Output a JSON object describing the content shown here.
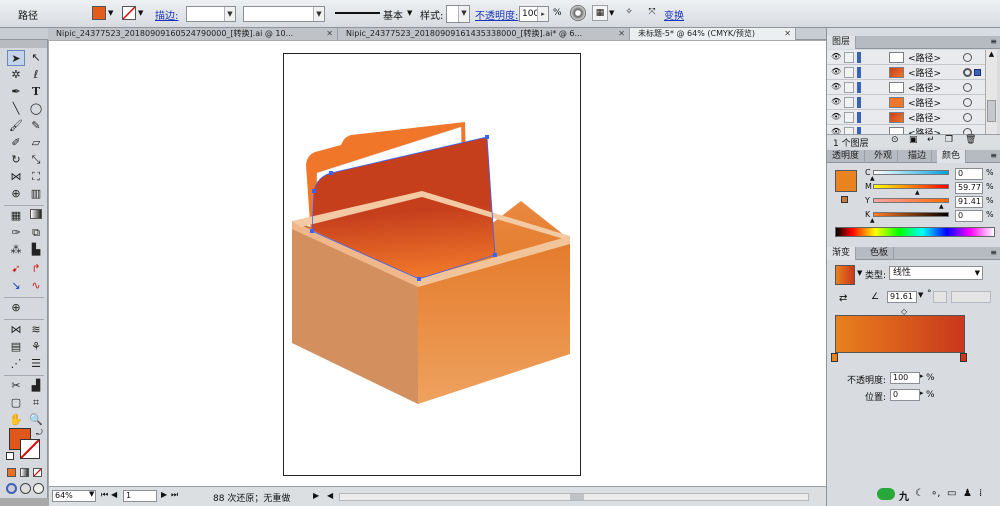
{
  "control_bar": {
    "object_type": "路径",
    "fill_color": "#e35d1a",
    "stroke_label": "描边:",
    "stroke_profile": "基本",
    "style_label": "样式:",
    "opacity_label": "不透明度:",
    "opacity_value": "100",
    "opacity_unit": "%",
    "transform_label": "变换"
  },
  "doc_tabs": [
    {
      "label": "Nipic_24377523_20180909160524790000_[转换].ai @ 10...",
      "active": false
    },
    {
      "label": "Nipic_24377523_20180909161435338000_[转换].ai* @ 6...",
      "active": false
    },
    {
      "label": "未标题-5* @ 64% (CMYK/预览)",
      "active": true
    }
  ],
  "tools": {
    "fill_color": "#e0571b",
    "stroke_color": "none"
  },
  "status_bar": {
    "zoom": "64%",
    "artboard": "1",
    "history": "88 次还原；无重做"
  },
  "layers_panel": {
    "tab": "图层",
    "rows": [
      {
        "name": "<路径>",
        "thumb": "white"
      },
      {
        "name": "<路径>",
        "thumb": "orange-shape"
      },
      {
        "name": "<路径>",
        "thumb": "white"
      },
      {
        "name": "<路径>",
        "thumb": "orange-rect"
      },
      {
        "name": "<路径>",
        "thumb": "orange-shape"
      },
      {
        "name": "<路径>",
        "thumb": "white"
      }
    ],
    "footer": "1 个图层"
  },
  "color_panel": {
    "tabs": [
      "透明度",
      "外观",
      "描边",
      "颜色"
    ],
    "active_tab": "颜色",
    "swatch": "#e8831f",
    "channels": [
      {
        "label": "C",
        "value": "0",
        "fraction": 0.0,
        "gradient": [
          "#ffffff",
          "#00a0e0"
        ]
      },
      {
        "label": "M",
        "value": "59.77",
        "fraction": 0.5977,
        "gradient": [
          "#ffff00",
          "#ff0000"
        ]
      },
      {
        "label": "Y",
        "value": "91.41",
        "fraction": 0.9141,
        "gradient": [
          "#f9a3a3",
          "#ff6a00"
        ]
      },
      {
        "label": "K",
        "value": "0",
        "fraction": 0.0,
        "gradient": [
          "#ff7a20",
          "#000000"
        ]
      }
    ],
    "unit": "%"
  },
  "gradient_panel": {
    "tabs": [
      "渐变",
      "色板"
    ],
    "active_tab": "渐变",
    "type_label": "类型:",
    "type_value": "线性",
    "angle": "91.61",
    "angle_unit": "°",
    "gradient_colors": [
      "#e8801c",
      "#c9381d"
    ],
    "opacity_label": "不透明度:",
    "opacity_value": "100",
    "position_label": "位置:",
    "position_value": "0",
    "unit": "%"
  },
  "colors": {
    "box_top": "#f0b88a",
    "box_left": "#d48f5f",
    "box_right_top": "#e47a2a",
    "box_right_bottom": "#eea25f",
    "inner": "#e8883f",
    "folder_light": "#f0762a",
    "folder_dark": "#c63f1d"
  }
}
